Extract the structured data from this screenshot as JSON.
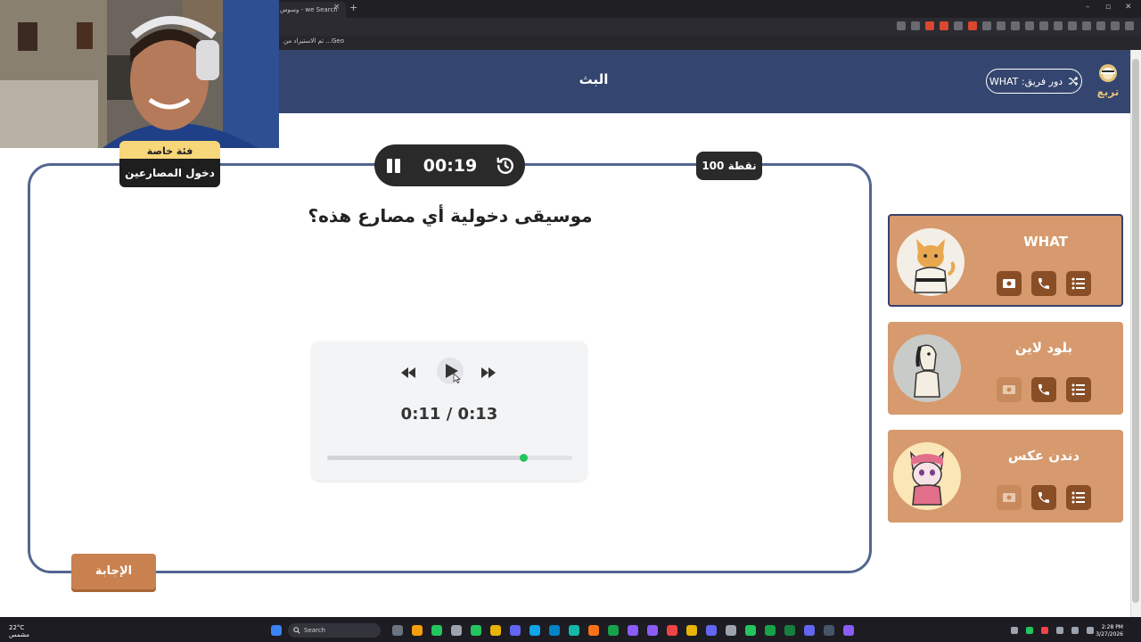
{
  "browser": {
    "tab_title": "وسوس - we Search",
    "tab_close": "×",
    "new_tab": "+",
    "bookmark_label": "تم الاستيراد من ...Geo",
    "window_controls": [
      "–",
      "▫",
      "✕"
    ]
  },
  "header": {
    "title": "البث",
    "team_turn_label": "دور فريق: WHAT",
    "logo_text": "تربع"
  },
  "question_card": {
    "category_top": "فئة خاصة",
    "category": "دخول المصارعين",
    "timer": "00:19",
    "points": "100 نقطة",
    "question": "موسيقى دخولية أي مصارع هذه؟",
    "answer_button": "الإجابة"
  },
  "audio_player": {
    "time_display": "0:11 / 0:13",
    "progress": 0.8
  },
  "teams": [
    {
      "name": "WHAT",
      "active": true,
      "avatar": "cat-judo-avatar",
      "accent": "#f3efe6"
    },
    {
      "name": "بلود لاين",
      "active": false,
      "avatar": "horse-avatar",
      "accent": "#c9cbc8"
    },
    {
      "name": "دندن عكس",
      "active": false,
      "avatar": "cat-scarf-avatar",
      "accent": "#fbe6b7"
    }
  ],
  "taskbar": {
    "weather_temp": "22°C",
    "weather_desc": "مشمس",
    "search_placeholder": "Search",
    "time": "2:28 PM",
    "date": "3/27/2026"
  },
  "colors": {
    "header_bg": "#34466f",
    "card_border": "#536690",
    "team_card_bg": "#d69a6e",
    "team_btn": "#8a4e26",
    "answer_btn": "#c9814f",
    "category_top": "#f8d77b",
    "progress_knob": "#22c55e"
  }
}
